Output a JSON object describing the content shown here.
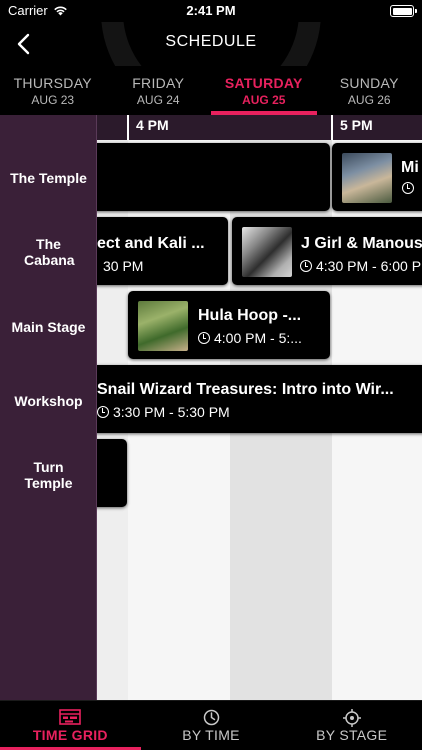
{
  "status_bar": {
    "carrier": "Carrier",
    "time": "2:41 PM",
    "battery_percent": 100
  },
  "nav": {
    "title": "SCHEDULE"
  },
  "days": [
    {
      "name": "THURSDAY",
      "date": "AUG 23",
      "active": false
    },
    {
      "name": "FRIDAY",
      "date": "AUG 24",
      "active": false
    },
    {
      "name": "SATURDAY",
      "date": "AUG 25",
      "active": true
    },
    {
      "name": "SUNDAY",
      "date": "AUG 26",
      "active": false
    }
  ],
  "time_labels": [
    "4 PM",
    "5 PM"
  ],
  "stages": [
    "The Temple",
    "The Cabana",
    "Main Stage",
    "Workshop",
    "Turn Temple"
  ],
  "events": [
    {
      "stage": "The Temple",
      "title": "",
      "time": ""
    },
    {
      "stage": "The Temple",
      "title": "Mi",
      "time": ""
    },
    {
      "stage": "The Cabana",
      "title": "ect and Kali ...",
      "time": "30 PM"
    },
    {
      "stage": "The Cabana",
      "title": "J Girl & Manous",
      "time": "4:30 PM - 6:00 P"
    },
    {
      "stage": "Main Stage",
      "title": "Hula Hoop -...",
      "time": "4:00 PM - 5:..."
    },
    {
      "stage": "Workshop",
      "title": "Snail Wizard Treasures: Intro into Wir...",
      "time": "3:30 PM - 5:30 PM"
    },
    {
      "stage": "Turn Temple",
      "title": "",
      "time": ""
    }
  ],
  "bottom_tabs": [
    {
      "label": "TIME GRID",
      "icon": "calendar-grid-icon",
      "active": true
    },
    {
      "label": "BY TIME",
      "icon": "clock-icon",
      "active": false
    },
    {
      "label": "BY STAGE",
      "icon": "location-target-icon",
      "active": false
    }
  ],
  "colors": {
    "accent": "#e8215e",
    "stage_column": "#3a2038",
    "event_bg": "#000000"
  }
}
